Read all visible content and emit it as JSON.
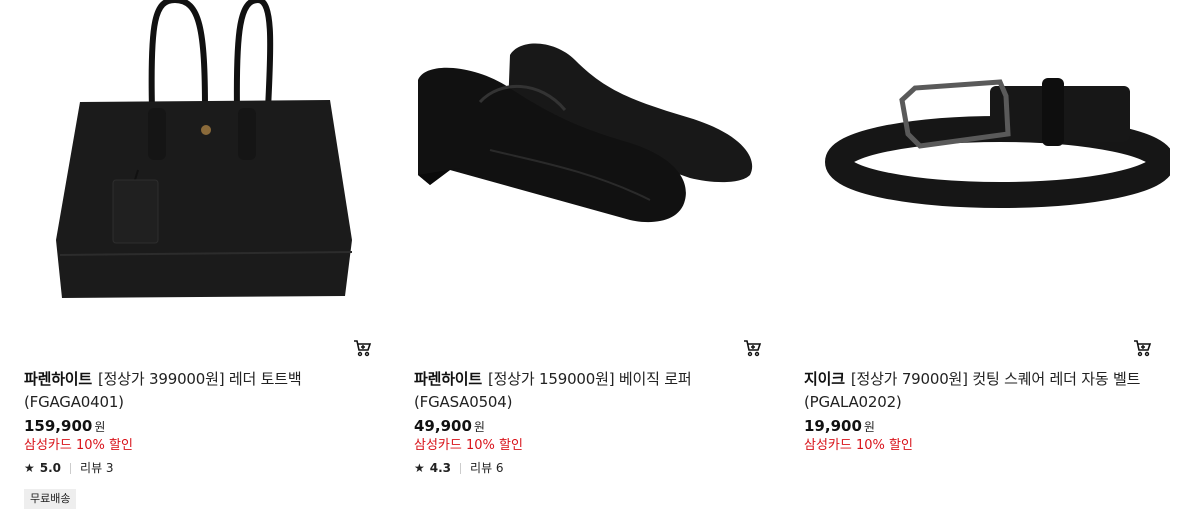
{
  "products": [
    {
      "image": "black-leather-tote-bag",
      "brand": "파렌하이트",
      "name": "[정상가 399000원] 레더 토트백",
      "code": "(FGAGA0401)",
      "price": "159,900",
      "unit": "원",
      "promo": "삼성카드 10% 할인",
      "rating": "5.0",
      "reviews": "리뷰 3",
      "tag": "무료배송"
    },
    {
      "image": "black-leather-penny-loafers",
      "brand": "파렌하이트",
      "name": "[정상가 159000원] 베이직 로퍼",
      "code": "(FGASA0504)",
      "price": "49,900",
      "unit": "원",
      "promo": "삼성카드 10% 할인",
      "rating": "4.3",
      "reviews": "리뷰 6"
    },
    {
      "image": "black-leather-belt",
      "brand": "지이크",
      "name": "[정상가 79000원] 컷팅 스퀘어 레더 자동 벨트",
      "code": "(PGALA0202)",
      "price": "19,900",
      "unit": "원",
      "promo": "삼성카드 10% 할인"
    }
  ],
  "icons": {
    "cart": "cart-icon",
    "star": "star-icon"
  }
}
